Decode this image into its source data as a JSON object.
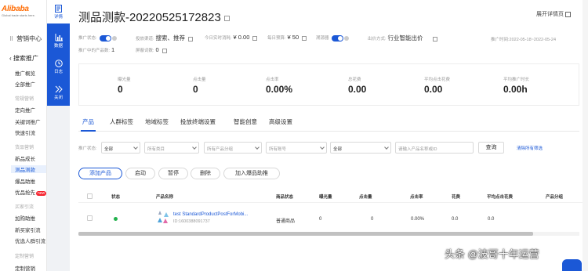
{
  "sidebar": {
    "logo_brand": "Alibaba",
    "logo_sub": "Global trade starts here.",
    "title": "营销中心",
    "back_label": "搜索推广",
    "items": [
      {
        "type": "item",
        "label": "推广概览"
      },
      {
        "type": "item",
        "label": "全部推广"
      },
      {
        "type": "group",
        "label": "常规营销"
      },
      {
        "type": "item",
        "label": "定向推广"
      },
      {
        "type": "item",
        "label": "关键词推广"
      },
      {
        "type": "item",
        "label": "快速引流"
      },
      {
        "type": "group",
        "label": "货品营销"
      },
      {
        "type": "item",
        "label": "新品成长"
      },
      {
        "type": "item",
        "label": "测品测款",
        "active": true
      },
      {
        "type": "item",
        "label": "爆品助推"
      },
      {
        "type": "item",
        "label": "优品抢先",
        "badge": "new"
      },
      {
        "type": "group",
        "label": "买家引流"
      },
      {
        "type": "item",
        "label": "加购助推"
      },
      {
        "type": "item",
        "label": "新买家引流"
      },
      {
        "type": "item",
        "label": "优选人群引流",
        "badge": "new"
      },
      {
        "type": "group",
        "label": "定制营销"
      },
      {
        "type": "item",
        "label": "定制营销"
      }
    ]
  },
  "rail": [
    {
      "label": "详情",
      "icon": "document-icon",
      "active": true
    },
    {
      "label": "数据",
      "icon": "bar-chart-icon"
    },
    {
      "label": "日志",
      "icon": "clock-icon"
    },
    {
      "label": "关闭",
      "icon": "double-chevron-right-icon"
    }
  ],
  "header": {
    "title": "测品测款-20220525172823",
    "expand_label": "展开详情页"
  },
  "meta": {
    "status_label": "推广状态:",
    "channel_label": "投放渠道:",
    "channel_value": "搜索、推荐",
    "today_spend_label": "今日实时消耗:",
    "today_spend_value": "¥ 0.00",
    "daily_budget_label": "每日预算:",
    "daily_budget_value": "¥ 50",
    "smart_label": "溯源器",
    "bid_label": "出价方式:",
    "bid_value": "行业智能出价",
    "period_label": "推广时间:",
    "period_value": "2022-05-18~2022-05-24",
    "products_label": "推广中的产品数:",
    "products_value": "1",
    "blocked_label": "屏蔽词数:",
    "blocked_value": "0"
  },
  "stats": [
    {
      "label": "曝光量",
      "value": "0"
    },
    {
      "label": "点击量",
      "value": "0"
    },
    {
      "label": "点击率",
      "value": "0.00%"
    },
    {
      "label": "总花费",
      "value": "0.00"
    },
    {
      "label": "平均点击花费",
      "value": "0.00"
    },
    {
      "label": "平均推广时长",
      "value": "0.00h"
    }
  ],
  "tabs": [
    "产品",
    "人群标签",
    "地域标签",
    "投放终端设置",
    "智能创意",
    "高级设置"
  ],
  "filters": {
    "status_label": "推广状态:",
    "status_value": "全部",
    "group_placeholder": "所有类目",
    "product_group_placeholder": "所有产品分组",
    "account_placeholder": "所有账号",
    "type_value": "全部",
    "search_placeholder": "请输入产品名称或ID",
    "query_label": "查询",
    "clear_label": "清除所有筛选"
  },
  "actions": [
    "添加产品",
    "启动",
    "暂停",
    "删除",
    "加入爆品助推"
  ],
  "table": {
    "headers": [
      "状态",
      "产品名称",
      "商品状态",
      "曝光量",
      "点击量",
      "点击率",
      "花费",
      "平均点击花费",
      "产品分组"
    ],
    "rows": [
      {
        "name": "test StandardProductPostForMobi...",
        "id": "ID:1600388091737",
        "product_status": "普通商品",
        "impressions": "0",
        "clicks": "0",
        "ctr": "0.00%",
        "spend": "0.0",
        "avg_cpc": "0.0"
      }
    ]
  },
  "watermark": "头条 @波哥十年运营"
}
